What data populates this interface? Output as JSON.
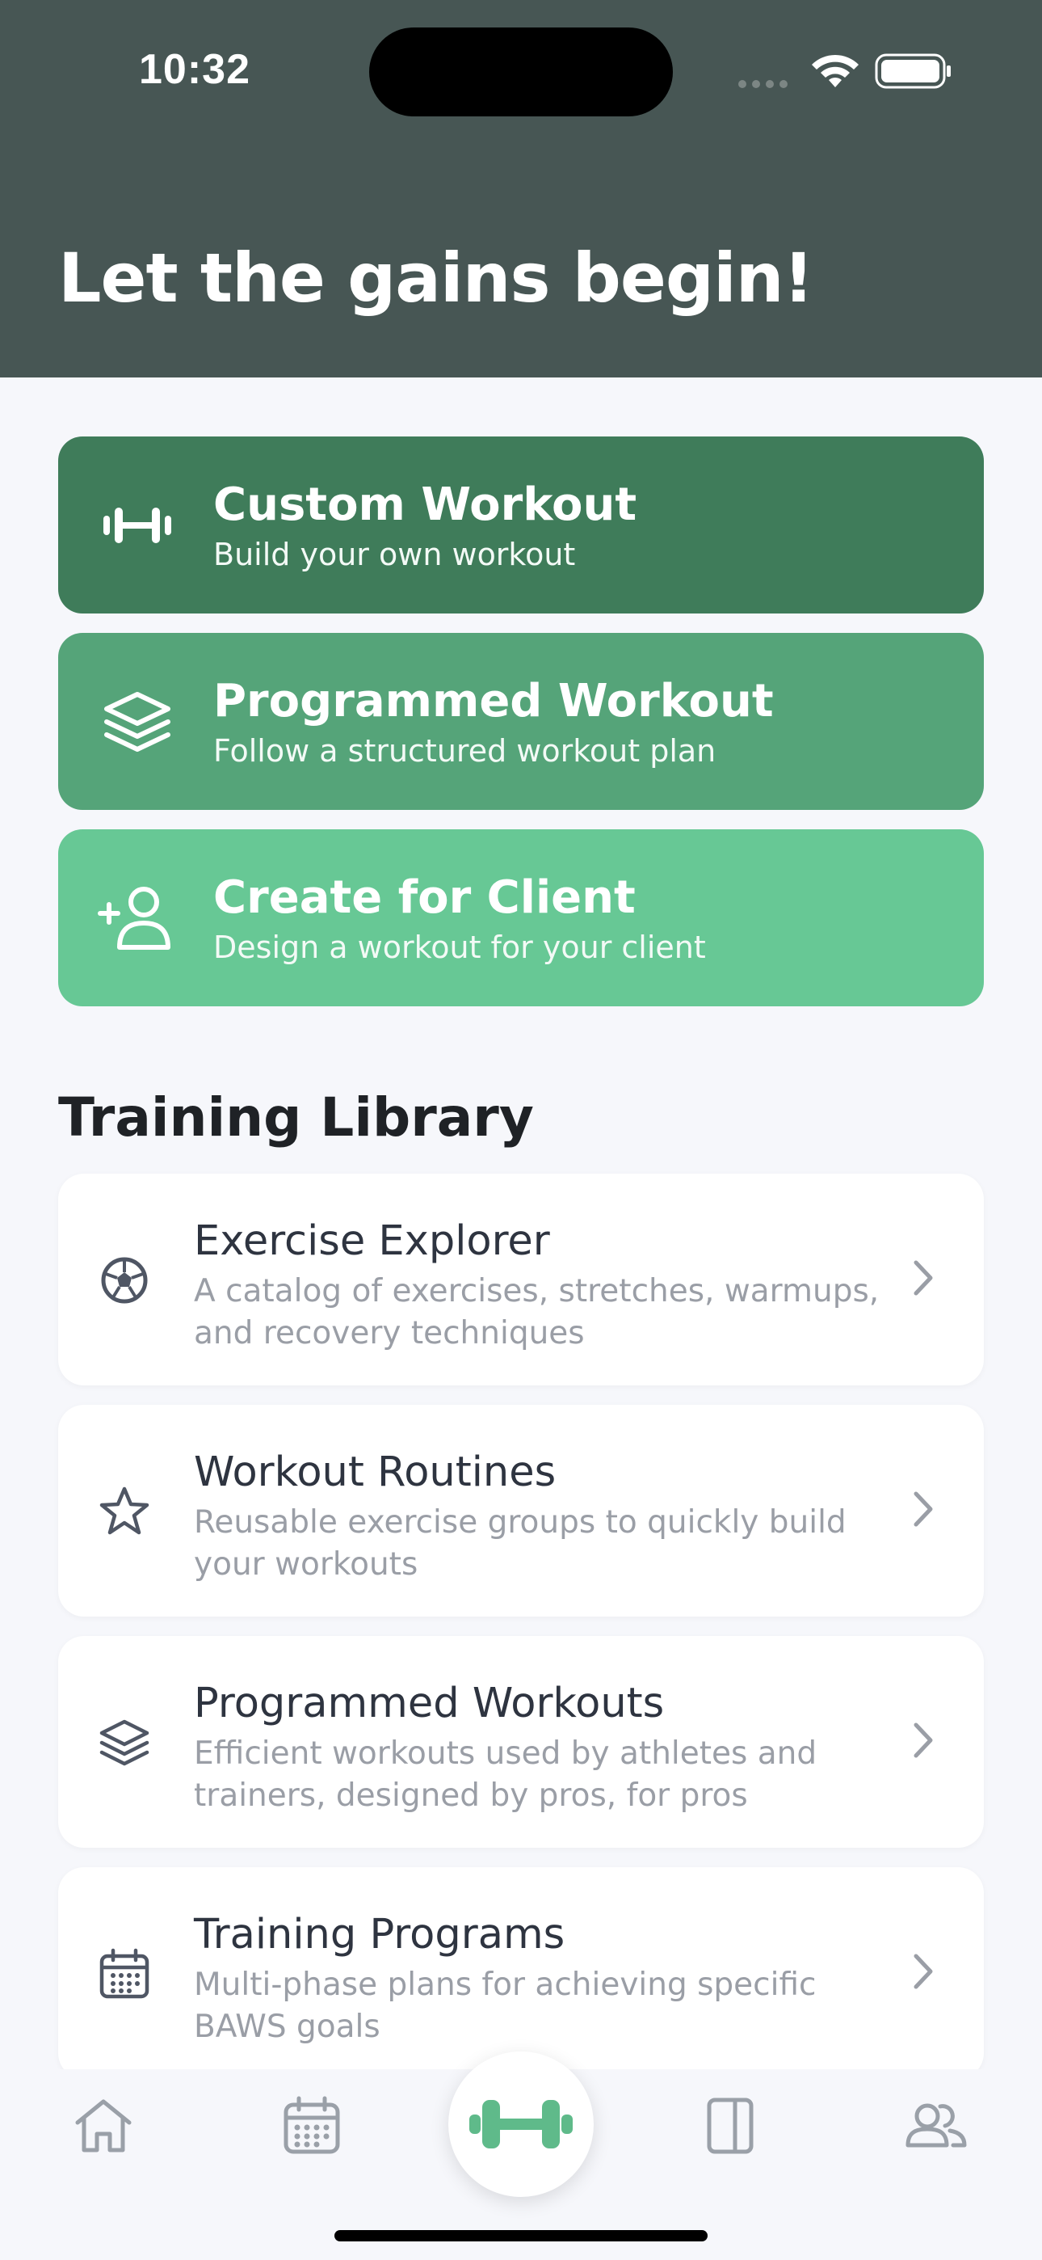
{
  "status_bar": {
    "time": "10:32"
  },
  "header": {
    "title": "Let the gains begin!"
  },
  "actions": [
    {
      "title": "Custom Workout",
      "subtitle": "Build your own workout",
      "icon": "dumbbell-icon",
      "color": "#3f7c5a"
    },
    {
      "title": "Programmed Workout",
      "subtitle": "Follow a structured workout plan",
      "icon": "layers-icon",
      "color": "#55a479"
    },
    {
      "title": "Create for Client",
      "subtitle": "Design a workout for your client",
      "icon": "add-user-icon",
      "color": "#67c895"
    }
  ],
  "library": {
    "title": "Training Library",
    "items": [
      {
        "title": "Exercise Explorer",
        "description": "A catalog of exercises, stretches, warmups, and recovery techniques",
        "icon": "soccer-ball-icon"
      },
      {
        "title": "Workout Routines",
        "description": "Reusable exercise groups to quickly build your workouts",
        "icon": "star-icon"
      },
      {
        "title": "Programmed Workouts",
        "description": "Efficient workouts used by athletes and trainers, designed by pros, for pros",
        "icon": "layers-icon"
      },
      {
        "title": "Training Programs",
        "description": "Multi-phase plans for achieving specific BAWS goals",
        "icon": "calendar-icon"
      }
    ]
  },
  "tab_bar": {
    "tabs": [
      "home-icon",
      "calendar-icon",
      "dumbbell-icon",
      "book-icon",
      "users-icon"
    ],
    "active": "dumbbell-icon",
    "accent": "#5fba8a"
  }
}
